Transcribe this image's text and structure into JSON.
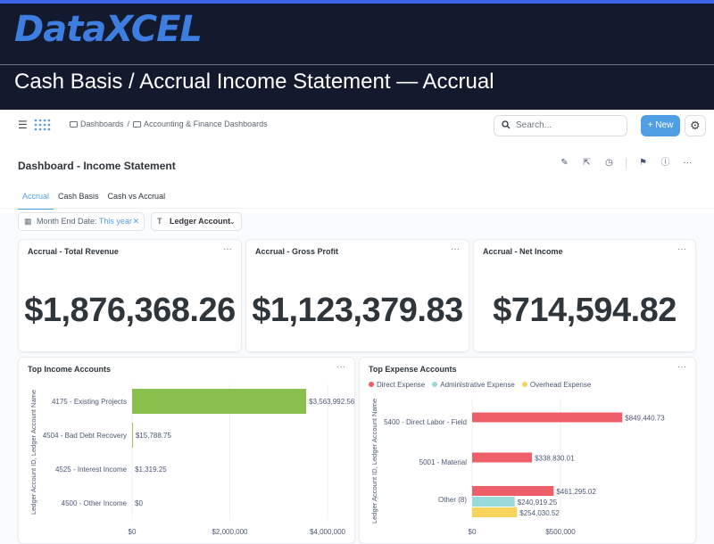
{
  "banner": {
    "logo_data": "Data",
    "logo_x": "X",
    "logo_cel": "CEL",
    "title": "Cash Basis / Accrual Income Statement — Accrual"
  },
  "appbar": {
    "breadcrumb": [
      "Dashboards",
      "/",
      "Accounting & Finance Dashboards"
    ],
    "search_placeholder": "Search...",
    "new_label": "+ New",
    "menu_icon": "menu-icon",
    "settings_icon": "gear-icon"
  },
  "dashboard": {
    "title": "Dashboard - Income Statement",
    "tabs": [
      "Accrual",
      "Cash Basis",
      "Cash vs Accrual"
    ],
    "active_tab": "Accrual",
    "action_icons": [
      "pencil-icon",
      "share-icon",
      "clock-icon",
      "bookmark-icon",
      "info-icon",
      "more-icon"
    ]
  },
  "filters": {
    "date_label": "Month End Date:",
    "date_value": "This year",
    "ledger_label": "Ledger Account"
  },
  "kpis": [
    {
      "title": "Accrual - Total Revenue",
      "value": "$1,876,368.26"
    },
    {
      "title": "Accrual - Gross Profit",
      "value": "$1,123,379.83"
    },
    {
      "title": "Accrual - Net Income",
      "value": "$714,594.82"
    }
  ],
  "more_glyph": "···",
  "colors": {
    "accent": "#509ee3",
    "income_bar": "#88bf4d",
    "direct_expense": "#ef5f6a",
    "administrative_expense": "#98d9d9",
    "overhead_expense": "#f9d45c",
    "banner_bg": "#141a2e"
  },
  "chart_data": [
    {
      "type": "bar",
      "orientation": "horizontal",
      "title": "Top Income Accounts",
      "ylabel": "Ledger Account ID, Ledger Account Name",
      "categories": [
        "4175 - Existing Projects",
        "4504 - Bad Debt Recovery",
        "4525 - Interest Income",
        "4500 - Other Income"
      ],
      "values": [
        3563992.56,
        15788.75,
        1319.25,
        0
      ],
      "value_labels": [
        "$3,563,992.56",
        "$15,788.75",
        "$1,319.25",
        "$0"
      ],
      "xlim": [
        0,
        4000000
      ],
      "x_ticks": [
        "$0",
        "$2,000,000",
        "$4,000,000"
      ],
      "grid": true
    },
    {
      "type": "bar",
      "orientation": "horizontal",
      "title": "Top Expense Accounts",
      "ylabel": "Ledger Account ID, Ledger Account Name",
      "categories": [
        "5400 - Direct Labor - Field",
        "5001 - Material",
        "Other (8)"
      ],
      "series": [
        {
          "name": "Direct Expense",
          "values": [
            849440.73,
            338830.01,
            461295.02
          ],
          "labels": [
            "$849,440.73",
            "$338,830.01",
            "$461,295.02"
          ]
        },
        {
          "name": "Administrative Expense",
          "values": [
            null,
            null,
            240919.25
          ],
          "labels": [
            "",
            "",
            "$240,919.25"
          ]
        },
        {
          "name": "Overhead Expense",
          "values": [
            null,
            null,
            254030.52
          ],
          "labels": [
            "",
            "",
            "$254,030.52"
          ]
        }
      ],
      "xlim": [
        0,
        1000000
      ],
      "x_ticks": [
        "$0",
        "$500,000"
      ],
      "legend": "top-left",
      "grid": true
    }
  ]
}
